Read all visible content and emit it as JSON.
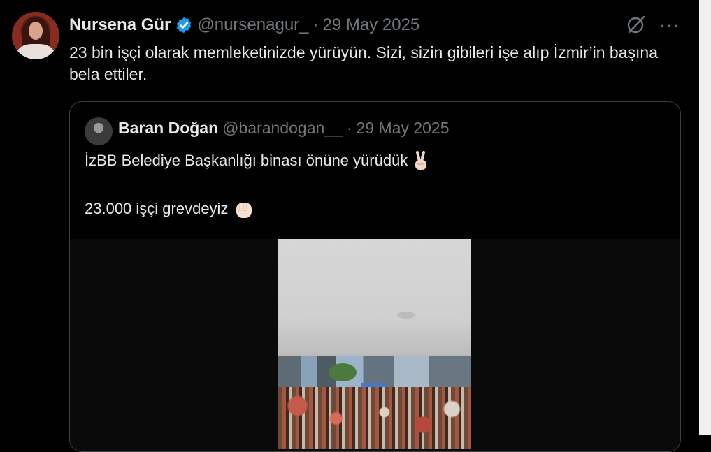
{
  "tweet": {
    "author_name": "Nursena Gür",
    "handle": "@nursenagur_",
    "separator": "·",
    "date": "29 May 2025",
    "text": "23 bin işçi olarak memleketinizde yürüyün. Sizi, sizin gibileri işe alıp İzmir’in başına bela ettiler.",
    "more_label": "···"
  },
  "quote": {
    "author_name": "Baran Doğan",
    "handle": "@barandogan__",
    "separator": "·",
    "date": "29 May 2025",
    "line1": "İzBB Belediye Başkanlığı binası önüne yürüdük",
    "line2": "23.000 işçi grevdeyiz"
  },
  "colors": {
    "background": "#000000",
    "text": "#e7e9ea",
    "muted": "#71767b",
    "verified": "#1d9bf0",
    "border": "#3a3f44"
  },
  "icons": [
    "verified-badge-icon",
    "grok-icon",
    "more-icon",
    "victory-hand-emoji",
    "raised-fist-emoji"
  ]
}
